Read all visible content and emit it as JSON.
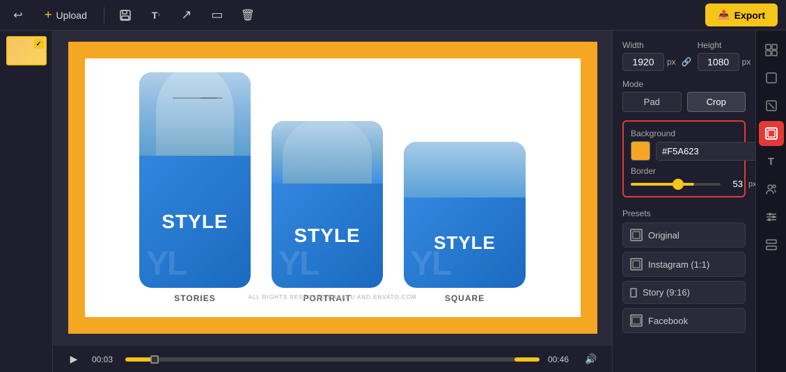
{
  "toolbar": {
    "upload_label": "Upload",
    "export_label": "Export"
  },
  "timeline": {
    "start_time": "00:03",
    "end_time": "00:46"
  },
  "right_panel": {
    "width_label": "Width",
    "height_label": "Height",
    "width_value": "1920",
    "height_value": "1080",
    "px_unit": "px",
    "mode_label": "Mode",
    "pad_label": "Pad",
    "crop_label": "Crop",
    "background_label": "Background",
    "color_hex": "#F5A623",
    "border_label": "Border",
    "border_value": "53",
    "presets_label": "Presets",
    "preset_original": "Original",
    "preset_instagram": "Instagram (1:1)",
    "preset_story": "Story (9:16)",
    "preset_facebook": "Facebook"
  },
  "canvas": {
    "cards": [
      {
        "style": "STYLE",
        "label": "STORIES",
        "watermark": "YL"
      },
      {
        "style": "STYLE",
        "label": "PORTRAIT",
        "watermark": "YL"
      },
      {
        "style": "STYLE",
        "label": "SQUARE",
        "watermark": "YL"
      }
    ],
    "copyright": "ALL RIGHTS RESERVED BRAKKU AND ENVATO.COM"
  },
  "icons": {
    "undo": "↩",
    "plus": "+",
    "save": "💾",
    "text": "T",
    "arrow": "↗",
    "rect": "□",
    "trash": "🗑",
    "export_icon": "📤",
    "link": "🔗",
    "play": "▶",
    "volume": "🔊",
    "grid": "⊞",
    "layers": "⬜",
    "crop_icon": "⊡",
    "frame_icon": "⊟",
    "crop_active": "✂",
    "text_icon": "T",
    "people": "👥",
    "sliders": "⚙",
    "more": "⊟"
  }
}
